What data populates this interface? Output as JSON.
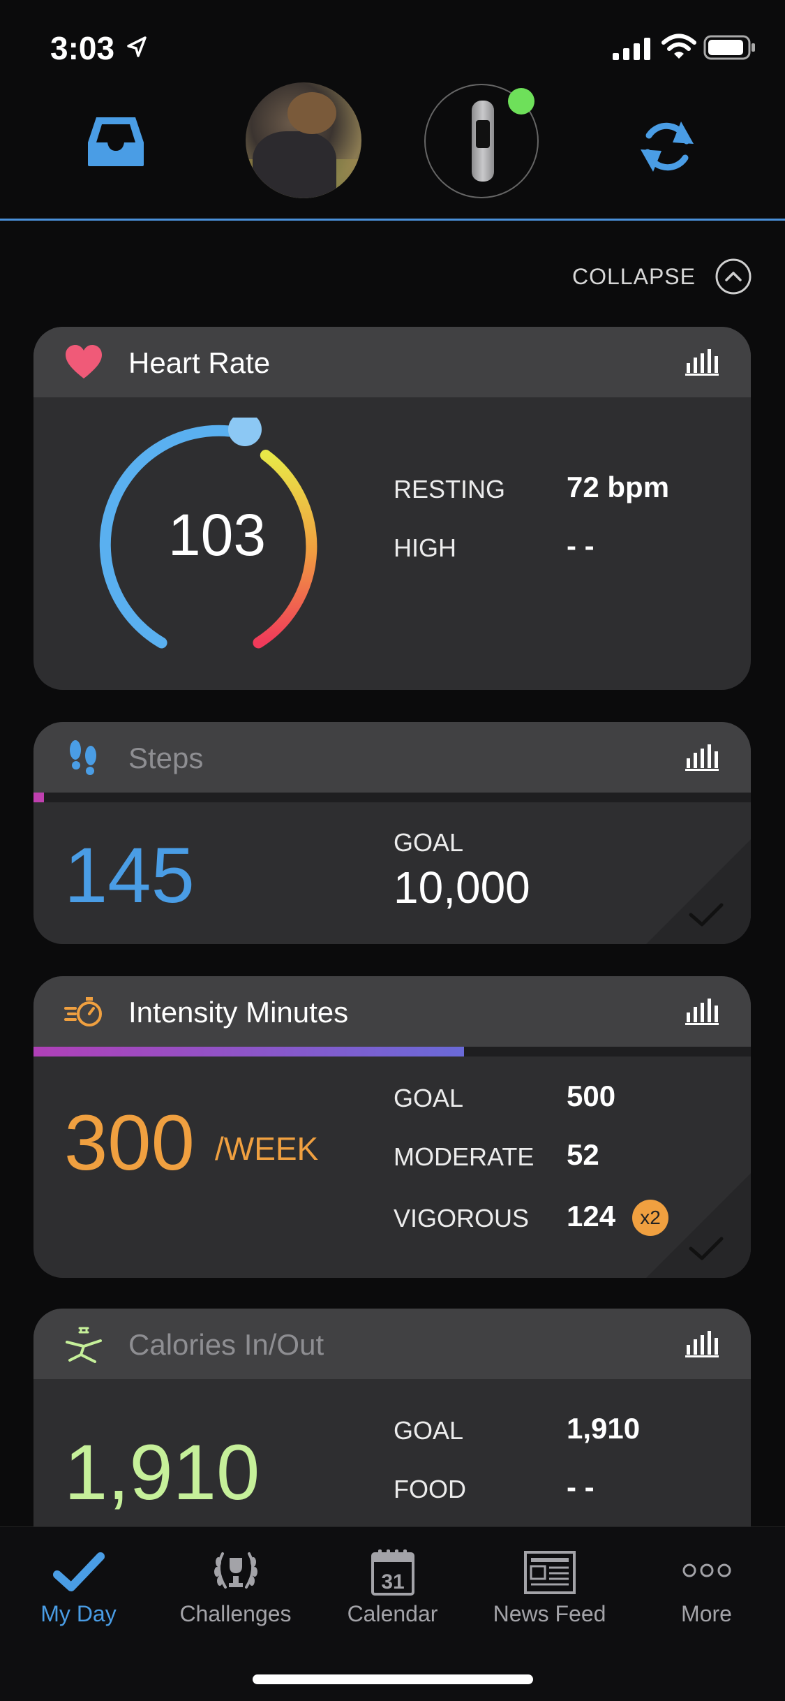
{
  "status_bar": {
    "time": "3:03"
  },
  "collapse": {
    "label": "COLLAPSE"
  },
  "heart_rate": {
    "title": "Heart Rate",
    "current": "103",
    "resting_label": "RESTING",
    "resting_value": "72 bpm",
    "high_label": "HIGH",
    "high_value": "- -",
    "gauge_level": 0.38
  },
  "steps": {
    "title": "Steps",
    "count": "145",
    "goal_label": "GOAL",
    "goal_value": "10,000",
    "progress": 0.0145
  },
  "intensity": {
    "title": "Intensity Minutes",
    "total": "300",
    "unit": "/WEEK",
    "goal_label": "GOAL",
    "goal_value": "500",
    "moderate_label": "MODERATE",
    "moderate_value": "52",
    "vigorous_label": "VIGOROUS",
    "vigorous_value": "124",
    "vigorous_badge": "x2",
    "progress": 0.6
  },
  "calories": {
    "title": "Calories In/Out",
    "total": "1,910",
    "goal_label": "GOAL",
    "goal_value": "1,910",
    "food_label": "FOOD",
    "food_value": "- -"
  },
  "tabs": [
    {
      "label": "My Day",
      "icon": "checkmark-icon",
      "active": true
    },
    {
      "label": "Challenges",
      "icon": "laurel-trophy-icon",
      "active": false
    },
    {
      "label": "Calendar",
      "icon": "calendar-icon",
      "active": false
    },
    {
      "label": "News Feed",
      "icon": "newspaper-icon",
      "active": false
    },
    {
      "label": "More",
      "icon": "more-dots-icon",
      "active": false
    }
  ],
  "calendar_icon_day": "31",
  "colors": {
    "accent": "#4a9de5",
    "heart": "#f05a78",
    "steps": "#4a9de5",
    "intensity": "#f0a040",
    "calories": "#c6f09a",
    "card_bg": "#2e2e30",
    "card_header_bg": "#414143",
    "device_connected": "#6ee05a"
  }
}
